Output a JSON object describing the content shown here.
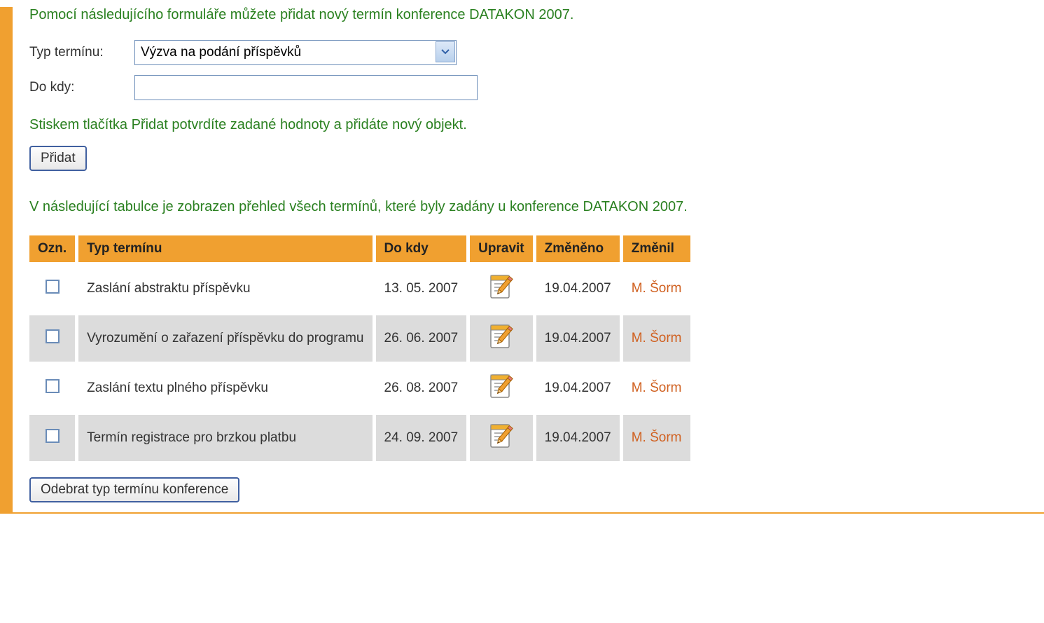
{
  "intro": "Pomocí následujícího formuláře můžete přidat nový termín konference DATAKON 2007.",
  "form": {
    "type_label": "Typ termínu:",
    "type_value": "Výzva na podání příspěvků",
    "deadline_label": "Do kdy:",
    "deadline_value": ""
  },
  "helper": "Stiskem tlačítka Přidat potvrdíte zadané hodnoty a přidáte nový objekt.",
  "add_button": "Přidat",
  "table_intro": "V následující tabulce je zobrazen přehled všech termínů, které byly zadány u konference DATAKON 2007.",
  "table": {
    "headers": {
      "check": "Ozn.",
      "type": "Typ termínu",
      "deadline": "Do kdy",
      "edit": "Upravit",
      "changed": "Změněno",
      "changed_by": "Změnil"
    },
    "rows": [
      {
        "type": "Zaslání abstraktu příspěvku",
        "deadline": "13. 05. 2007",
        "changed": "19.04.2007",
        "changed_by": "M. Šorm"
      },
      {
        "type": "Vyrozumění o zařazení příspěvku do programu",
        "deadline": "26. 06. 2007",
        "changed": "19.04.2007",
        "changed_by": "M. Šorm"
      },
      {
        "type": "Zaslání textu plného příspěvku",
        "deadline": "26. 08. 2007",
        "changed": "19.04.2007",
        "changed_by": "M. Šorm"
      },
      {
        "type": "Termín registrace pro brzkou platbu",
        "deadline": "24. 09. 2007",
        "changed": "19.04.2007",
        "changed_by": "M. Šorm"
      }
    ]
  },
  "remove_button": "Odebrat typ termínu konference"
}
